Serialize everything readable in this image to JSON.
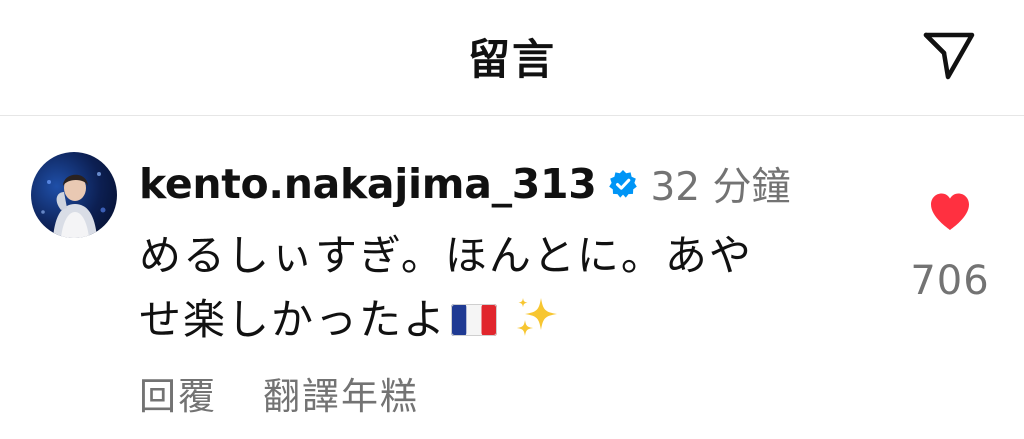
{
  "header": {
    "title": "留言",
    "share_icon": "paper-plane-icon"
  },
  "comment": {
    "username": "kento.nakajima_313",
    "verified": true,
    "time": "32 分鐘",
    "text_line1": "めるしぃすぎ。ほんとに。あや",
    "text_line2": "せ楽しかったよ",
    "emojis": [
      "flag-france-icon",
      "sparkles-icon"
    ],
    "like_count": "706",
    "liked": true,
    "actions": {
      "reply": "回覆",
      "translate": "翻譯年糕"
    }
  },
  "colors": {
    "text": "#111111",
    "muted": "#737373",
    "like": "#ff3040",
    "verified": "#0095f6",
    "divider": "#e6e6e6"
  }
}
